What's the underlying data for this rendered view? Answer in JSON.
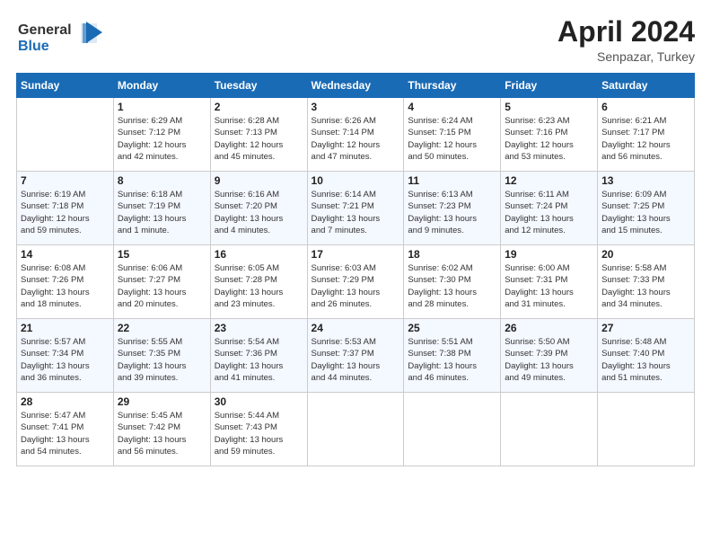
{
  "header": {
    "logo_line1": "General",
    "logo_line2": "Blue",
    "month": "April 2024",
    "location": "Senpazar, Turkey"
  },
  "days_of_week": [
    "Sunday",
    "Monday",
    "Tuesday",
    "Wednesday",
    "Thursday",
    "Friday",
    "Saturday"
  ],
  "weeks": [
    [
      {
        "day": "",
        "info": ""
      },
      {
        "day": "1",
        "info": "Sunrise: 6:29 AM\nSunset: 7:12 PM\nDaylight: 12 hours\nand 42 minutes."
      },
      {
        "day": "2",
        "info": "Sunrise: 6:28 AM\nSunset: 7:13 PM\nDaylight: 12 hours\nand 45 minutes."
      },
      {
        "day": "3",
        "info": "Sunrise: 6:26 AM\nSunset: 7:14 PM\nDaylight: 12 hours\nand 47 minutes."
      },
      {
        "day": "4",
        "info": "Sunrise: 6:24 AM\nSunset: 7:15 PM\nDaylight: 12 hours\nand 50 minutes."
      },
      {
        "day": "5",
        "info": "Sunrise: 6:23 AM\nSunset: 7:16 PM\nDaylight: 12 hours\nand 53 minutes."
      },
      {
        "day": "6",
        "info": "Sunrise: 6:21 AM\nSunset: 7:17 PM\nDaylight: 12 hours\nand 56 minutes."
      }
    ],
    [
      {
        "day": "7",
        "info": "Sunrise: 6:19 AM\nSunset: 7:18 PM\nDaylight: 12 hours\nand 59 minutes."
      },
      {
        "day": "8",
        "info": "Sunrise: 6:18 AM\nSunset: 7:19 PM\nDaylight: 13 hours\nand 1 minute."
      },
      {
        "day": "9",
        "info": "Sunrise: 6:16 AM\nSunset: 7:20 PM\nDaylight: 13 hours\nand 4 minutes."
      },
      {
        "day": "10",
        "info": "Sunrise: 6:14 AM\nSunset: 7:21 PM\nDaylight: 13 hours\nand 7 minutes."
      },
      {
        "day": "11",
        "info": "Sunrise: 6:13 AM\nSunset: 7:23 PM\nDaylight: 13 hours\nand 9 minutes."
      },
      {
        "day": "12",
        "info": "Sunrise: 6:11 AM\nSunset: 7:24 PM\nDaylight: 13 hours\nand 12 minutes."
      },
      {
        "day": "13",
        "info": "Sunrise: 6:09 AM\nSunset: 7:25 PM\nDaylight: 13 hours\nand 15 minutes."
      }
    ],
    [
      {
        "day": "14",
        "info": "Sunrise: 6:08 AM\nSunset: 7:26 PM\nDaylight: 13 hours\nand 18 minutes."
      },
      {
        "day": "15",
        "info": "Sunrise: 6:06 AM\nSunset: 7:27 PM\nDaylight: 13 hours\nand 20 minutes."
      },
      {
        "day": "16",
        "info": "Sunrise: 6:05 AM\nSunset: 7:28 PM\nDaylight: 13 hours\nand 23 minutes."
      },
      {
        "day": "17",
        "info": "Sunrise: 6:03 AM\nSunset: 7:29 PM\nDaylight: 13 hours\nand 26 minutes."
      },
      {
        "day": "18",
        "info": "Sunrise: 6:02 AM\nSunset: 7:30 PM\nDaylight: 13 hours\nand 28 minutes."
      },
      {
        "day": "19",
        "info": "Sunrise: 6:00 AM\nSunset: 7:31 PM\nDaylight: 13 hours\nand 31 minutes."
      },
      {
        "day": "20",
        "info": "Sunrise: 5:58 AM\nSunset: 7:33 PM\nDaylight: 13 hours\nand 34 minutes."
      }
    ],
    [
      {
        "day": "21",
        "info": "Sunrise: 5:57 AM\nSunset: 7:34 PM\nDaylight: 13 hours\nand 36 minutes."
      },
      {
        "day": "22",
        "info": "Sunrise: 5:55 AM\nSunset: 7:35 PM\nDaylight: 13 hours\nand 39 minutes."
      },
      {
        "day": "23",
        "info": "Sunrise: 5:54 AM\nSunset: 7:36 PM\nDaylight: 13 hours\nand 41 minutes."
      },
      {
        "day": "24",
        "info": "Sunrise: 5:53 AM\nSunset: 7:37 PM\nDaylight: 13 hours\nand 44 minutes."
      },
      {
        "day": "25",
        "info": "Sunrise: 5:51 AM\nSunset: 7:38 PM\nDaylight: 13 hours\nand 46 minutes."
      },
      {
        "day": "26",
        "info": "Sunrise: 5:50 AM\nSunset: 7:39 PM\nDaylight: 13 hours\nand 49 minutes."
      },
      {
        "day": "27",
        "info": "Sunrise: 5:48 AM\nSunset: 7:40 PM\nDaylight: 13 hours\nand 51 minutes."
      }
    ],
    [
      {
        "day": "28",
        "info": "Sunrise: 5:47 AM\nSunset: 7:41 PM\nDaylight: 13 hours\nand 54 minutes."
      },
      {
        "day": "29",
        "info": "Sunrise: 5:45 AM\nSunset: 7:42 PM\nDaylight: 13 hours\nand 56 minutes."
      },
      {
        "day": "30",
        "info": "Sunrise: 5:44 AM\nSunset: 7:43 PM\nDaylight: 13 hours\nand 59 minutes."
      },
      {
        "day": "",
        "info": ""
      },
      {
        "day": "",
        "info": ""
      },
      {
        "day": "",
        "info": ""
      },
      {
        "day": "",
        "info": ""
      }
    ]
  ]
}
